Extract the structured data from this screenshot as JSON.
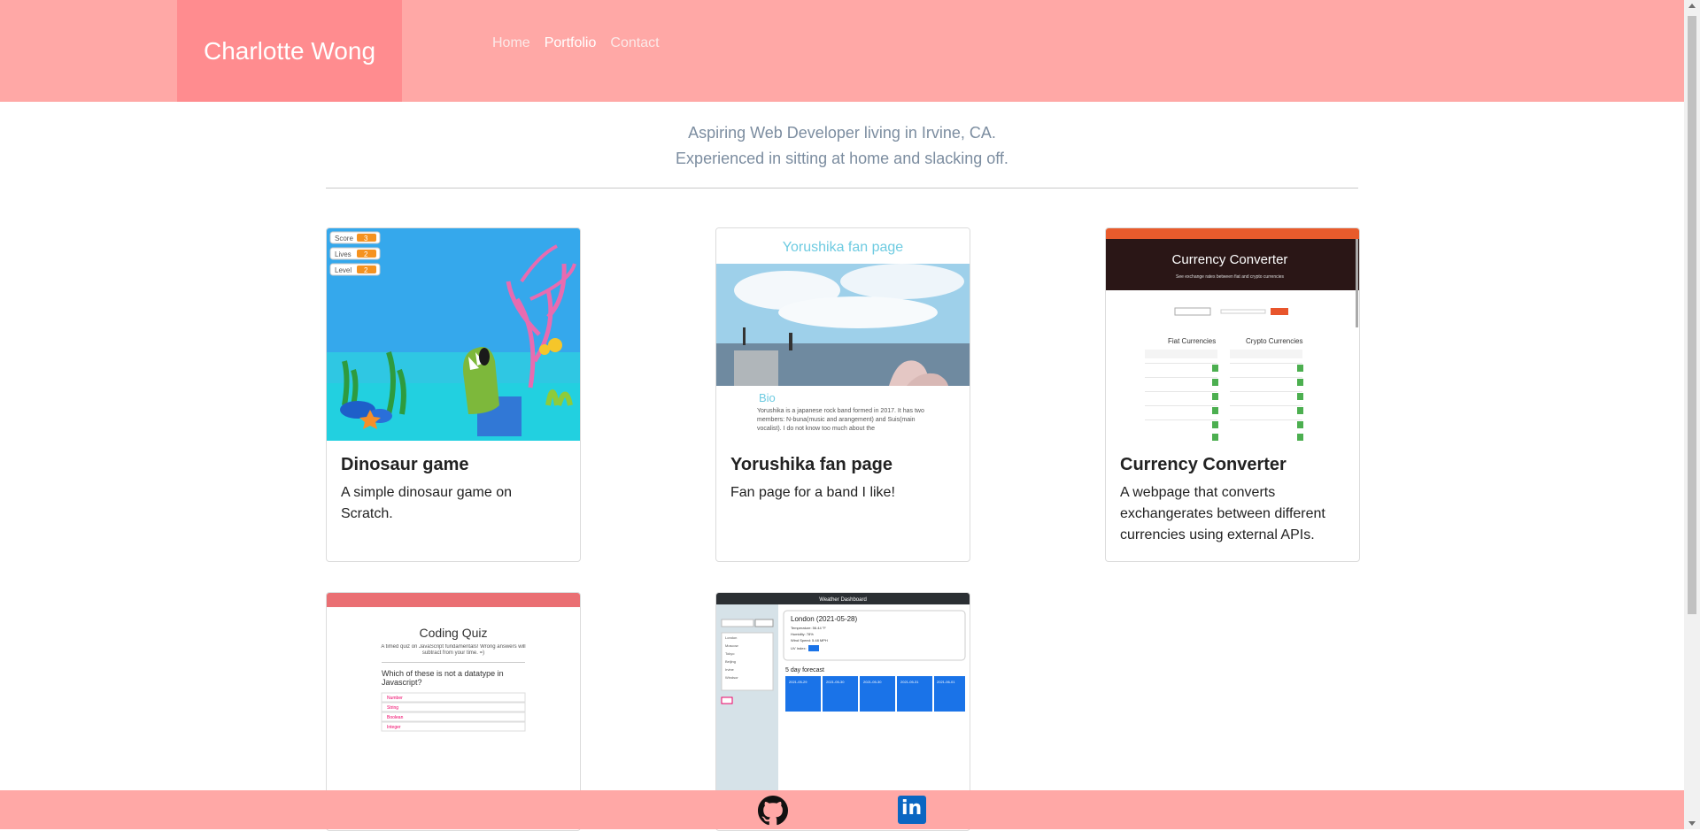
{
  "header": {
    "brand": "Charlotte Wong",
    "nav": [
      {
        "label": "Home"
      },
      {
        "label": "Portfolio",
        "active": true
      },
      {
        "label": "Contact"
      }
    ]
  },
  "intro": {
    "line1": "Aspiring Web Developer living in Irvine, CA.",
    "line2": "Experienced in sitting at home and slacking off."
  },
  "cards": [
    {
      "title": "Dinosaur game",
      "text": "A simple dinosaur game on Scratch.",
      "thumb": {
        "score_label": "Score",
        "lives_label": "Lives",
        "level_label": "Level",
        "score": "3",
        "lives": "2",
        "level": "2"
      }
    },
    {
      "title": "Yorushika fan page",
      "text": "Fan page for a band I like!",
      "thumb": {
        "heading": "Yorushika fan page",
        "bio_title": "Bio",
        "bio_text": "Yorushika is a japanese rock band formed in 2017. It has two members: N-buna(music and arangement) and Suis(main vocalist). I do not know too much about the"
      }
    },
    {
      "title": "Currency Converter",
      "text": "A webpage that converts exchangerates between different currencies using external APIs.",
      "thumb": {
        "heading": "Currency Converter",
        "sub": "See exchange rates between fiat and crypto currencies",
        "fiat": "Fiat Currencies",
        "crypto": "Crypto Currencies"
      }
    },
    {
      "title": "Coding Quiz",
      "text": "",
      "thumb": {
        "heading": "Coding Quiz",
        "sub": "A timed quiz on JavaScript fundamentals! Wrong answers will subtract from your time. =)",
        "question": "Which of these is not a datatype in Javascript?",
        "answers": [
          "Number",
          "String",
          "Boolean",
          "Integer"
        ]
      }
    },
    {
      "title": "Weather Dashboard",
      "text": "",
      "thumb": {
        "bar": "Weather Dashboard",
        "city": "London (2021-05-28)",
        "temp": "Temperature: 56.44 °F",
        "humidity": "Humidity: 78%",
        "wind": "Wind Speed: 5.48 MPH",
        "uv": "UV Index:",
        "forecast": "5 day forecast",
        "cities": [
          "London",
          "Moscow",
          "Tokyo",
          "Beijing",
          "Irvine",
          "Windsor"
        ],
        "days": [
          "2021-05-29",
          "2021-05-30",
          "2021-05-30",
          "2021-05-31",
          "2021-06-01"
        ]
      }
    }
  ],
  "footer": {
    "icons": [
      "github-icon",
      "linkedin-icon"
    ]
  },
  "colors": {
    "header": "#ffa8a6",
    "brand_bg": "#ff8c8f",
    "intro_text": "#7c8da0"
  }
}
